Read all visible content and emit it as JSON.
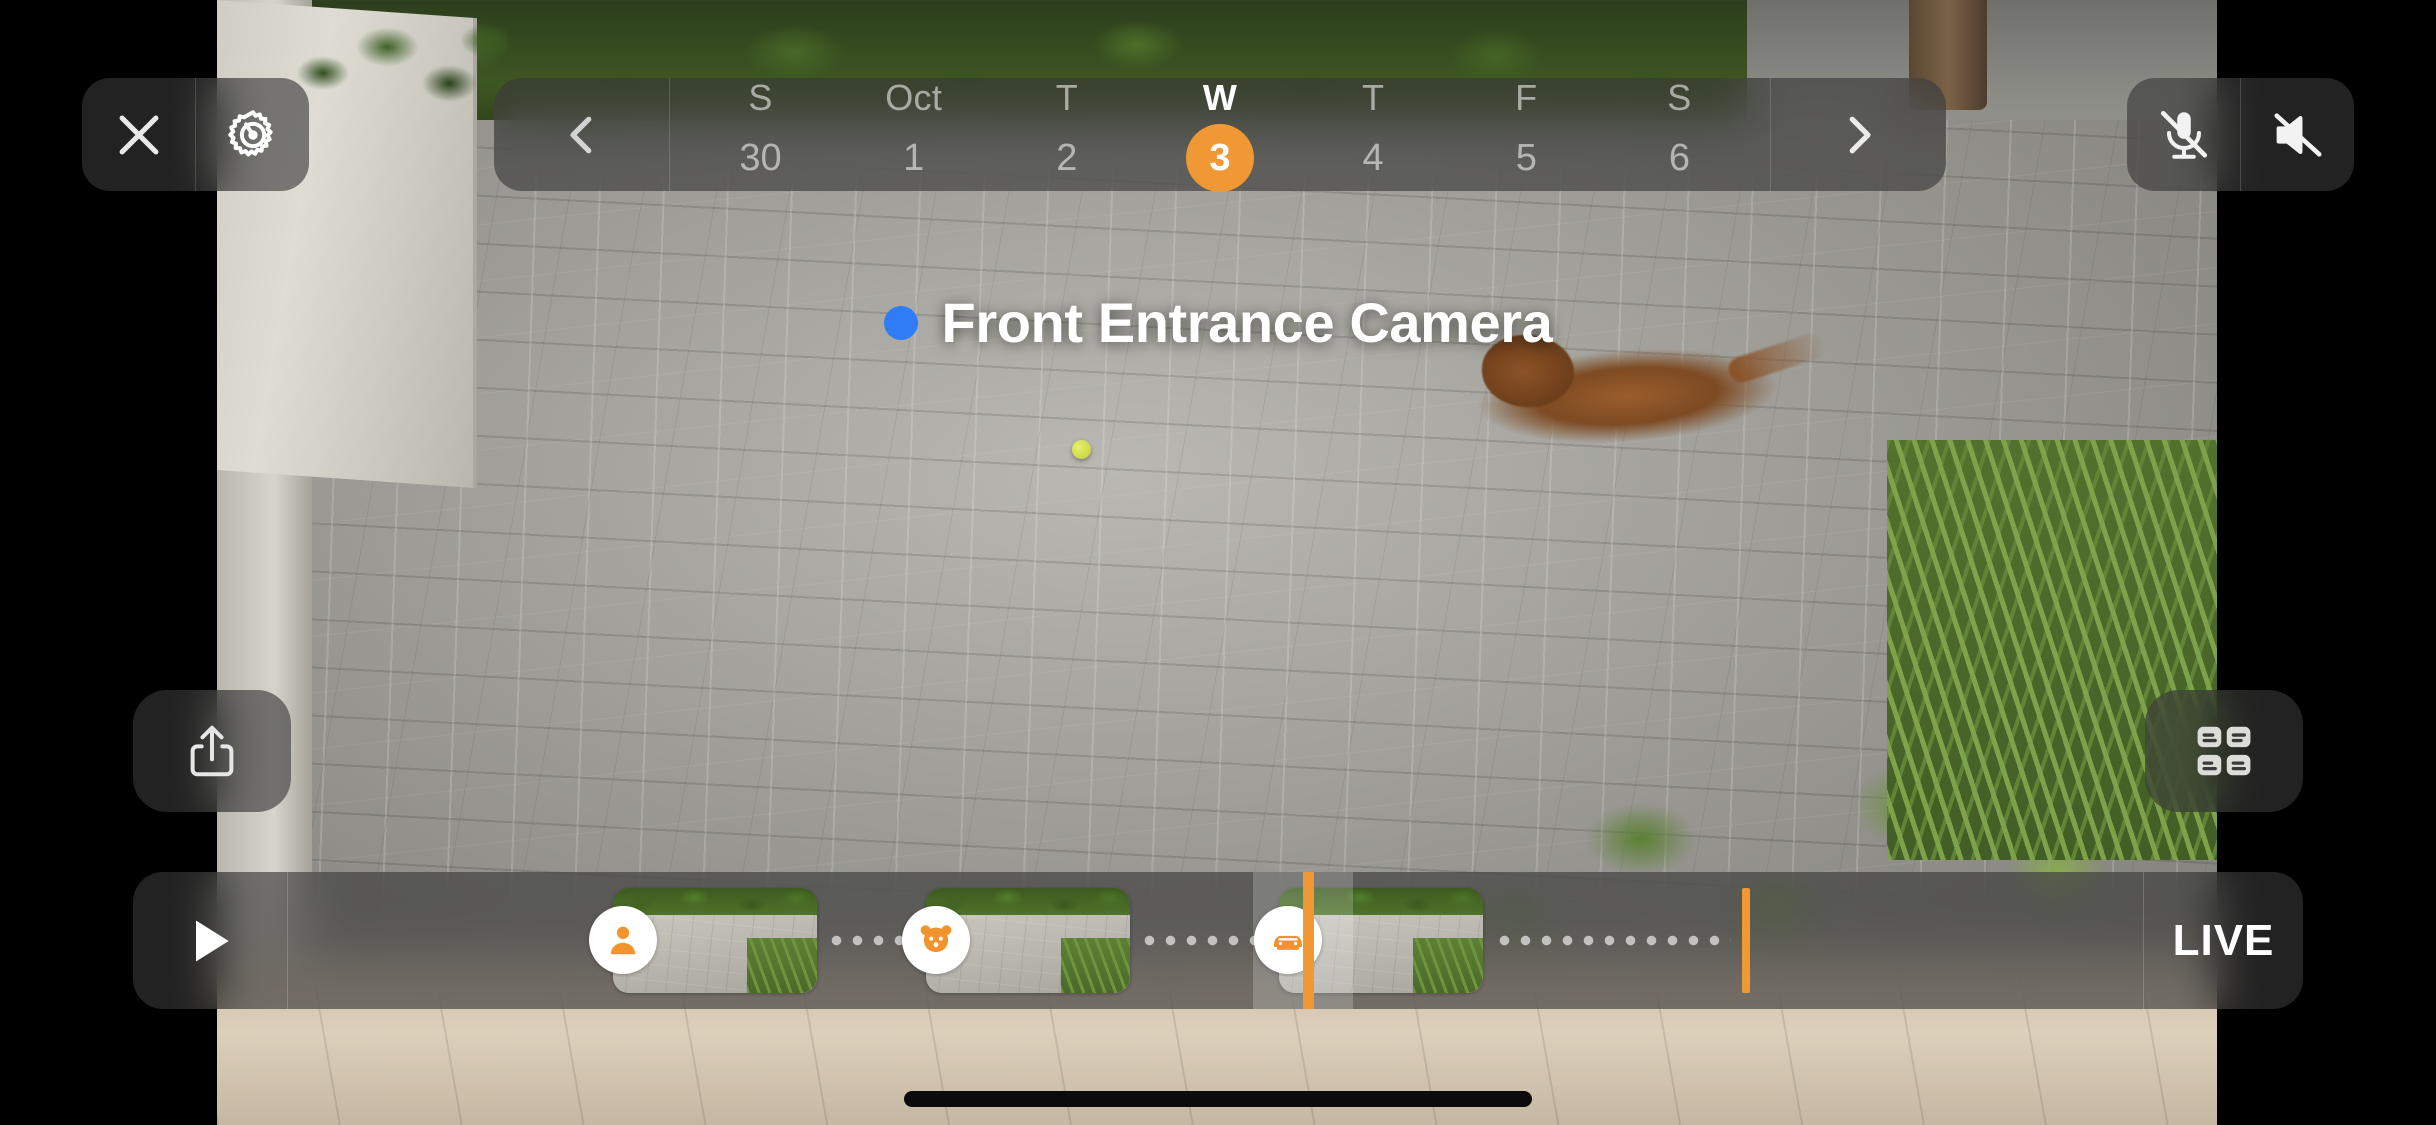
{
  "app": {
    "screen_name": "camera-live-view",
    "orientation": "landscape"
  },
  "colors": {
    "accent_orange": "#ef9834",
    "status_blue": "#2f7cf6",
    "chrome_fill": "rgba(55,55,55,0.62)",
    "text_primary": "#ffffff",
    "text_dim": "rgba(255,255,255,0.55)"
  },
  "top_left": {
    "close_icon": "close-icon",
    "settings_icon": "gear-icon"
  },
  "date_bar": {
    "prev_icon": "chevron-left-icon",
    "next_icon": "chevron-right-icon",
    "selected_index": 3,
    "days": [
      {
        "dow": "S",
        "num": "30"
      },
      {
        "dow": "Oct",
        "num": "1"
      },
      {
        "dow": "T",
        "num": "2"
      },
      {
        "dow": "W",
        "num": "3"
      },
      {
        "dow": "T",
        "num": "4"
      },
      {
        "dow": "F",
        "num": "5"
      },
      {
        "dow": "S",
        "num": "6"
      }
    ]
  },
  "top_right": {
    "mic_icon": "microphone-off-icon",
    "speaker_icon": "speaker-off-icon",
    "mic_state": "muted",
    "speaker_state": "muted"
  },
  "camera": {
    "name": "Front Entrance Camera",
    "status_dot": "recording-status-dot",
    "status_color": "#2f7cf6"
  },
  "side_controls": {
    "share_icon": "share-icon",
    "grid_icon": "grid-view-icon"
  },
  "timeline": {
    "play_icon": "play-icon",
    "live_label": "LIVE",
    "events": [
      {
        "type": "person",
        "icon": "person-icon",
        "left_pct": 17.5,
        "clip_left_pct": 17.5,
        "clip_width_pct": 11.0
      },
      {
        "type": "animal",
        "icon": "animal-icon",
        "left_pct": 34.4,
        "clip_left_pct": 34.4,
        "clip_width_pct": 11.0
      },
      {
        "type": "vehicle",
        "icon": "vehicle-icon",
        "left_pct": 53.4,
        "clip_left_pct": 53.4,
        "clip_width_pct": 11.0
      }
    ],
    "playhead_pct": 54.7,
    "live_marker_pct": 78.4
  },
  "system": {
    "home_indicator": "home-indicator"
  }
}
